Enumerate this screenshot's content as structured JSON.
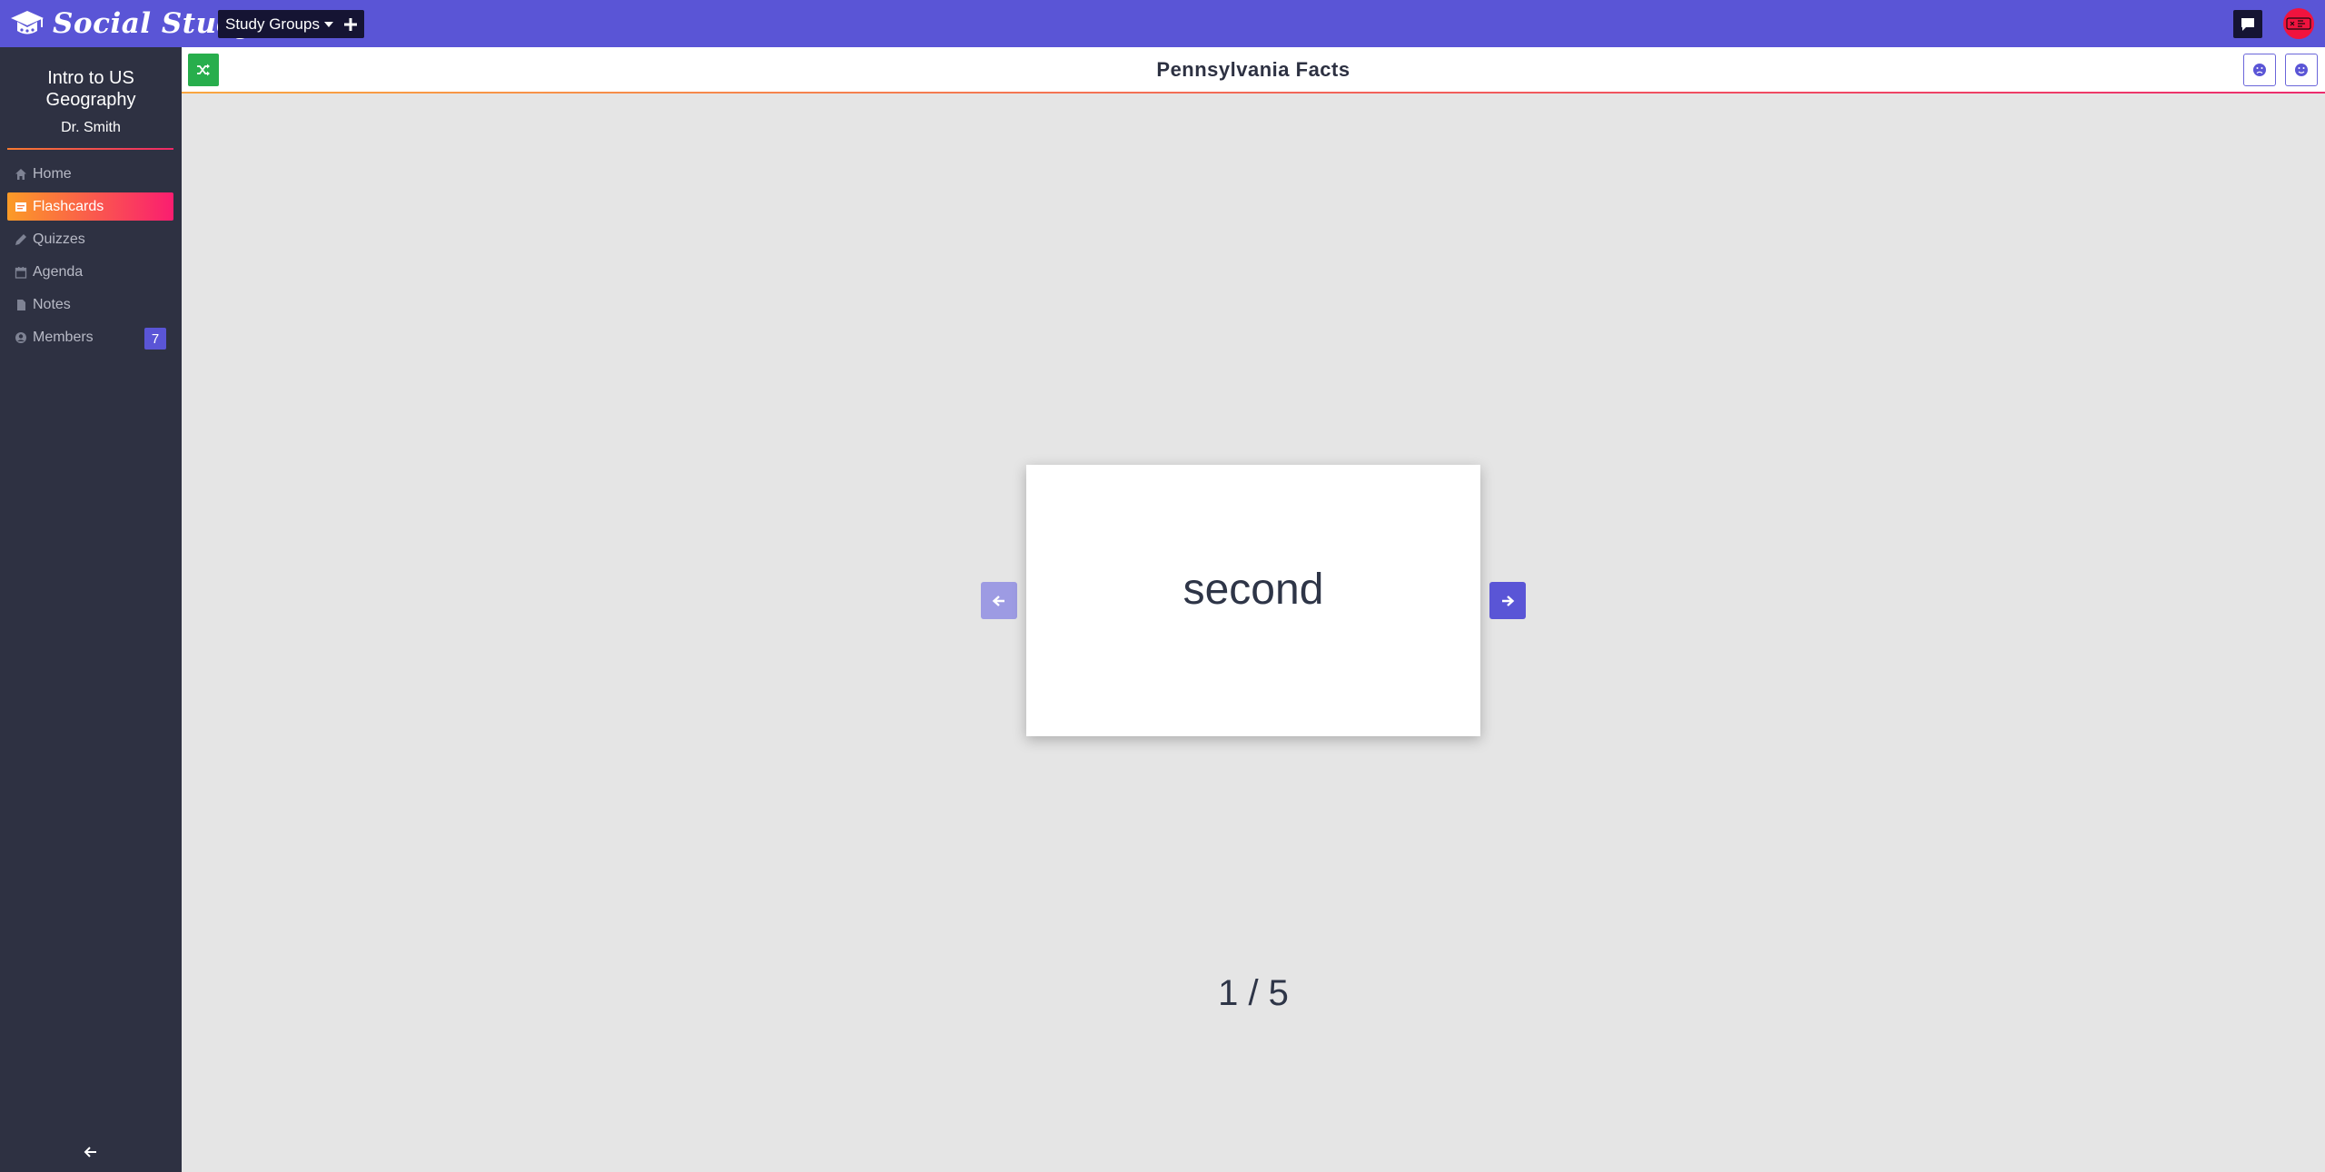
{
  "app": {
    "title": "Social Study",
    "colors": {
      "topbar": "#5a55d6",
      "sidebar": "#2e3142",
      "accent": "#5a55d6",
      "active_start": "#fb9b27",
      "active_end": "#fa1d70",
      "shuffle": "#27ae4c"
    }
  },
  "topbar": {
    "groups_dropdown_label": "Study Groups",
    "add_icon": "plus-icon",
    "chat_icon": "chat-icon",
    "avatar_icon": "avatar"
  },
  "sidebar": {
    "group_title": "Intro to US Geography",
    "teacher": "Dr. Smith",
    "items": [
      {
        "label": "Home",
        "icon": "home-icon",
        "active": false
      },
      {
        "label": "Flashcards",
        "icon": "flashcards-icon",
        "active": true
      },
      {
        "label": "Quizzes",
        "icon": "pencil-icon",
        "active": false
      },
      {
        "label": "Agenda",
        "icon": "calendar-icon",
        "active": false
      },
      {
        "label": "Notes",
        "icon": "file-icon",
        "active": false
      },
      {
        "label": "Members",
        "icon": "user-circle-icon",
        "active": false,
        "badge": "7"
      }
    ],
    "collapse_icon": "arrow-left-icon"
  },
  "deck": {
    "title": "Pennsylvania Facts",
    "shuffle_icon": "shuffle-icon",
    "frown_icon": "frown-icon",
    "smile_icon": "smile-icon"
  },
  "card": {
    "text": "second",
    "counter": "1 / 5"
  }
}
